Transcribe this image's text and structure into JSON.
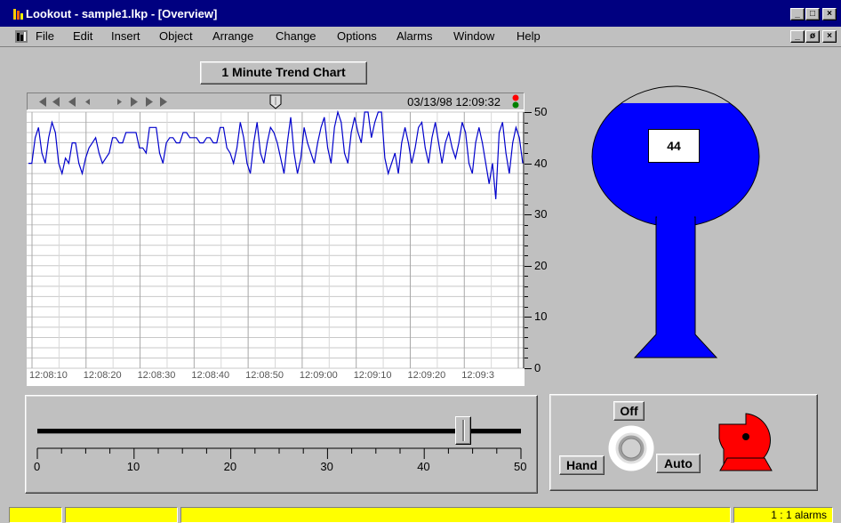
{
  "window": {
    "title": "Lookout - sample1.lkp - [Overview]",
    "minimize_glyph": "_",
    "maximize_glyph": "□",
    "close_glyph": "×",
    "restore_glyph": "ø"
  },
  "menu": {
    "items": [
      "File",
      "Edit",
      "Insert",
      "Object",
      "Arrange",
      "Change",
      "Options",
      "Alarms",
      "Window",
      "Help"
    ]
  },
  "trend": {
    "title_button": "1 Minute Trend Chart",
    "timestamp": "03/13/98 12:09:32",
    "line_color": "#0000cc",
    "background": "#ffffff",
    "chart_data": {
      "type": "line",
      "ylim": [
        0,
        50
      ],
      "y_ticks": [
        "50",
        "40",
        "30",
        "20",
        "10",
        "0"
      ],
      "x_ticks": [
        "12:08:10",
        "12:08:20",
        "12:08:30",
        "12:08:40",
        "12:08:50",
        "12:09:00",
        "12:09:10",
        "12:09:20",
        "12:09:3"
      ],
      "series": [
        {
          "values": [
            40,
            40,
            45,
            47,
            42,
            40,
            45,
            48,
            46,
            40,
            38,
            41,
            40,
            44,
            44,
            40,
            38,
            41,
            43,
            44,
            45,
            42,
            40,
            41,
            42,
            45,
            45,
            44,
            44,
            46,
            46,
            46,
            46,
            43,
            43,
            42,
            47,
            47,
            47,
            42,
            40,
            44,
            45,
            45,
            44,
            44,
            46,
            46,
            45,
            45,
            45,
            44,
            44,
            45,
            45,
            44,
            44,
            47,
            47,
            43,
            42,
            40,
            43,
            48,
            45,
            40,
            38,
            44,
            48,
            42,
            40,
            44,
            47,
            46,
            44,
            41,
            38,
            44,
            49,
            42,
            38,
            41,
            47,
            44,
            42,
            40,
            44,
            47,
            49,
            43,
            40,
            47,
            50,
            48,
            42,
            40,
            46,
            49,
            46,
            44,
            50,
            50,
            45,
            48,
            50,
            50,
            41,
            38,
            40,
            42,
            38,
            44,
            47,
            44,
            40,
            43,
            47,
            48,
            43,
            40,
            45,
            48,
            44,
            40,
            44,
            46,
            43,
            41,
            44,
            48,
            46,
            40,
            38,
            44,
            47,
            44,
            40,
            36,
            40,
            33,
            46,
            48,
            42,
            38,
            44,
            47,
            45,
            40
          ]
        }
      ]
    }
  },
  "tank": {
    "value": "44",
    "level": 44,
    "fill_color": "#0000ff"
  },
  "slider": {
    "value": 44,
    "min": 0,
    "max": 50,
    "scale_labels": [
      "0",
      "10",
      "20",
      "30",
      "40",
      "50"
    ]
  },
  "pump": {
    "off_label": "Off",
    "hand_label": "Hand",
    "auto_label": "Auto",
    "color": "#ff0000"
  },
  "status": {
    "alarms_text": "1 : 1 alarms",
    "cell_color": "#ffff00"
  }
}
